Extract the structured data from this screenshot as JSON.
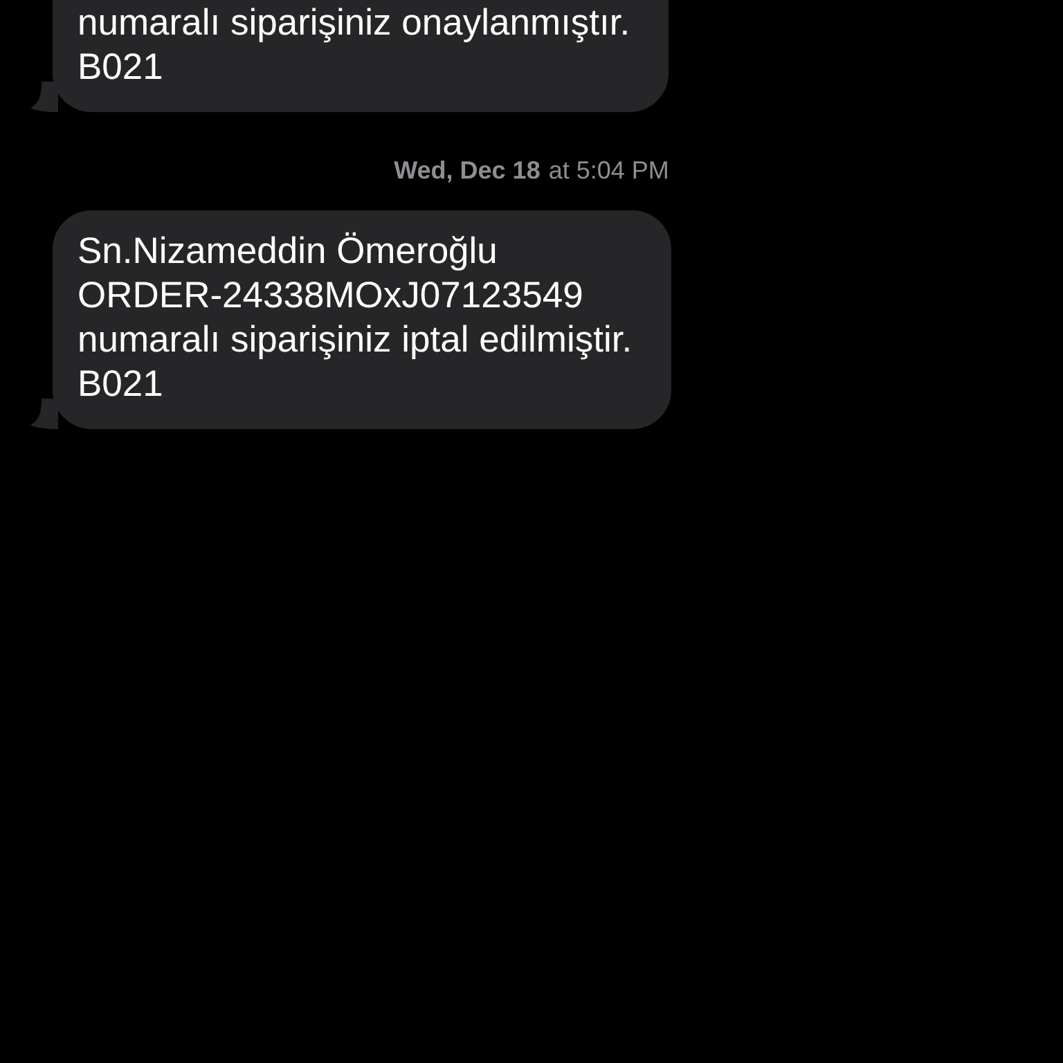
{
  "thread": [
    {
      "kind": "message",
      "cut_top": true,
      "lines": [
        "numaralı siparişiniz onaylanmıştır.",
        "B021"
      ]
    },
    {
      "kind": "timestamp",
      "day": "Wed, Dec 18",
      "time": "at 5:04 PM"
    },
    {
      "kind": "message",
      "cut_top": false,
      "lines": [
        "Sn.Nizameddin Ömeroğlu",
        "ORDER-24338MOxJ07123549",
        "numaralı siparişiniz iptal edilmiştir.",
        "B021"
      ]
    }
  ]
}
